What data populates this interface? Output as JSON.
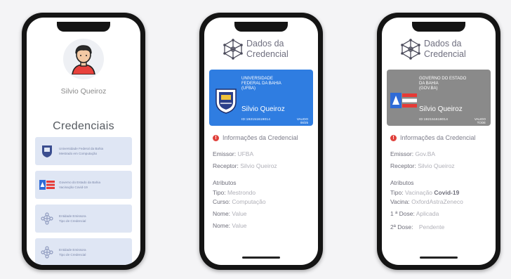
{
  "phone1": {
    "user_name": "Silvio Queiroz",
    "title": "Credenciais",
    "items": [
      {
        "line1": "Universidade Federal da Bahia",
        "line2": "Mestrado em Computação",
        "icon": "ufba-crest-icon"
      },
      {
        "line1": "Governo do Estado da Bahia",
        "line2": "Vacinação Covid-19",
        "icon": "bahia-flag-icon"
      },
      {
        "line1": "Entidade Emissora",
        "line2": "Tipo de Credencial",
        "icon": "network-icon"
      },
      {
        "line1": "Entidade Emissora",
        "line2": "Tipo de Credencial",
        "icon": "network-icon"
      }
    ]
  },
  "phone2": {
    "header_line1": "Dados da",
    "header_line2": "Credencial",
    "card": {
      "issuer_line1": "UNIVERSIDADE",
      "issuer_line2": "FEDERAL DA BAHIA",
      "issuer_line3": "(UFBA)",
      "holder": "Silvio Queiroz",
      "id": "ID:192151619014",
      "date_label": "VALIDO",
      "date": "08/25",
      "color": "#2f7de1"
    },
    "info_title": "Informações da Credencial",
    "emissor_label": "Emissor:",
    "emissor_value": "UFBA",
    "receptor_label": "Receptor:",
    "receptor_value": "Silvio Queiroz",
    "atributos_label": "Atributos",
    "attrs": [
      {
        "k": "Tipo:",
        "v": "Mestrondo"
      },
      {
        "k": "Curso:",
        "v": "Computação"
      },
      {
        "k": "Nome:",
        "v": "Value"
      },
      {
        "k": "Nome:",
        "v": "Value"
      }
    ]
  },
  "phone3": {
    "header_line1": "Dados da",
    "header_line2": "Credencial",
    "card": {
      "issuer_line1": "GOVERNO DO ESTADO",
      "issuer_line2": "DA BAHIA",
      "issuer_line3": "(GOV.BA)",
      "holder": "Silvio Queiroz",
      "id": "ID:192151618014",
      "date_label": "VALIDO",
      "date": "TODE",
      "color": "#8a8a8a"
    },
    "info_title": "Informações da Credencial",
    "emissor_label": "Emissor:",
    "emissor_value": "Gov.BA",
    "receptor_label": "Receptor:",
    "receptor_value": "Silvio Queiroz",
    "atributos_label": "Atributos",
    "tipo_label": "Tipo:",
    "tipo_value1": "Vacinação",
    "tipo_value2": "Covid-19",
    "vacina_label": "Vacina:",
    "vacina_value": "OxfordAstraZeneco",
    "dose1_label": "1 ª Dose:",
    "dose1_value": "Aplicada",
    "dose2_label": "2ª Dose:",
    "dose2_value": "Pendente"
  }
}
